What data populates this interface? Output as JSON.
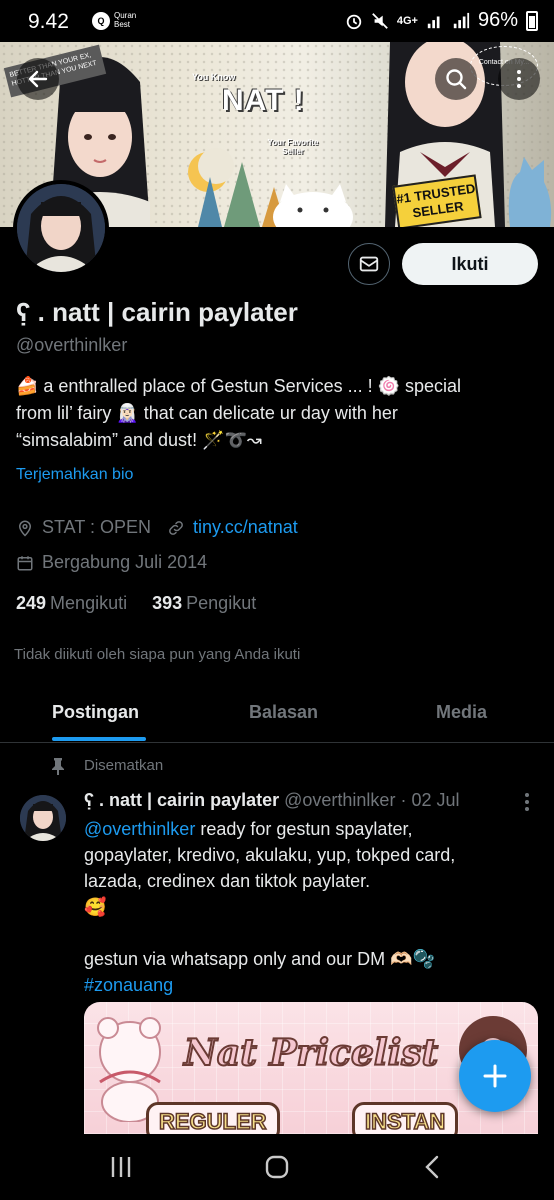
{
  "status_bar": {
    "time": "9.42",
    "quran_label": "Quran Best",
    "network": "4G+",
    "battery": "96%"
  },
  "banner": {
    "sticker_text": "BETTER THAN YOUR EX, HOTTER THAN YOU NEXT",
    "you_know": "You Know",
    "title": "NAT !",
    "subtitle": "Your Favorite Seller",
    "badge": "#1 TRUSTED SELLER",
    "contact": "Contact on My..."
  },
  "profile": {
    "follow_label": "Ikuti",
    "display_name": "ʕ̣ . natt | cairin paylater",
    "handle": "@overthinlker",
    "bio_line1": "🍰 a enthralled place of Gestun Services ... ! 🍥 special",
    "bio_line2": "from lil’ fairy 🧝🏻‍♀️ that can delicate ur day with her",
    "bio_line3": "“simsalabim” and dust! 🪄➰↝",
    "translate_label": "Terjemahkan bio",
    "location": "STAT : OPEN",
    "website": "tiny.cc/natnat",
    "joined": "Bergabung Juli 2014",
    "following_count": "249",
    "following_label": "Mengikuti",
    "followers_count": "393",
    "followers_label": "Pengikut",
    "not_followed": "Tidak diikuti oleh siapa pun yang Anda ikuti"
  },
  "tabs": [
    {
      "label": "Postingan"
    },
    {
      "label": "Balasan"
    },
    {
      "label": "Media"
    }
  ],
  "pinned_post": {
    "pinned_label": "Disematkan",
    "author_name": "ʕ̣ . natt | cairin paylater",
    "author_handle": "@overthinlker",
    "date": "· 02 Jul",
    "mention": "@overthinlker",
    "text_1": " ready for gestun spaylater,",
    "text_2": "gopaylater, kredivo, akulaku, yup, tokped card,",
    "text_3": "lazada, credinex dan tiktok paylater.",
    "text_4": "🥰",
    "text_5": "gestun via whatsapp only and our DM 🫶🏻🫧",
    "hashtag": "#zonauang",
    "image_title": "Nat Pricelist",
    "image_label_1": "REGULER",
    "image_label_2": "INSTAN"
  },
  "colors": {
    "accent": "#1d9bf0",
    "background": "#000000",
    "muted": "#71767b",
    "text": "#e7e9ea"
  }
}
